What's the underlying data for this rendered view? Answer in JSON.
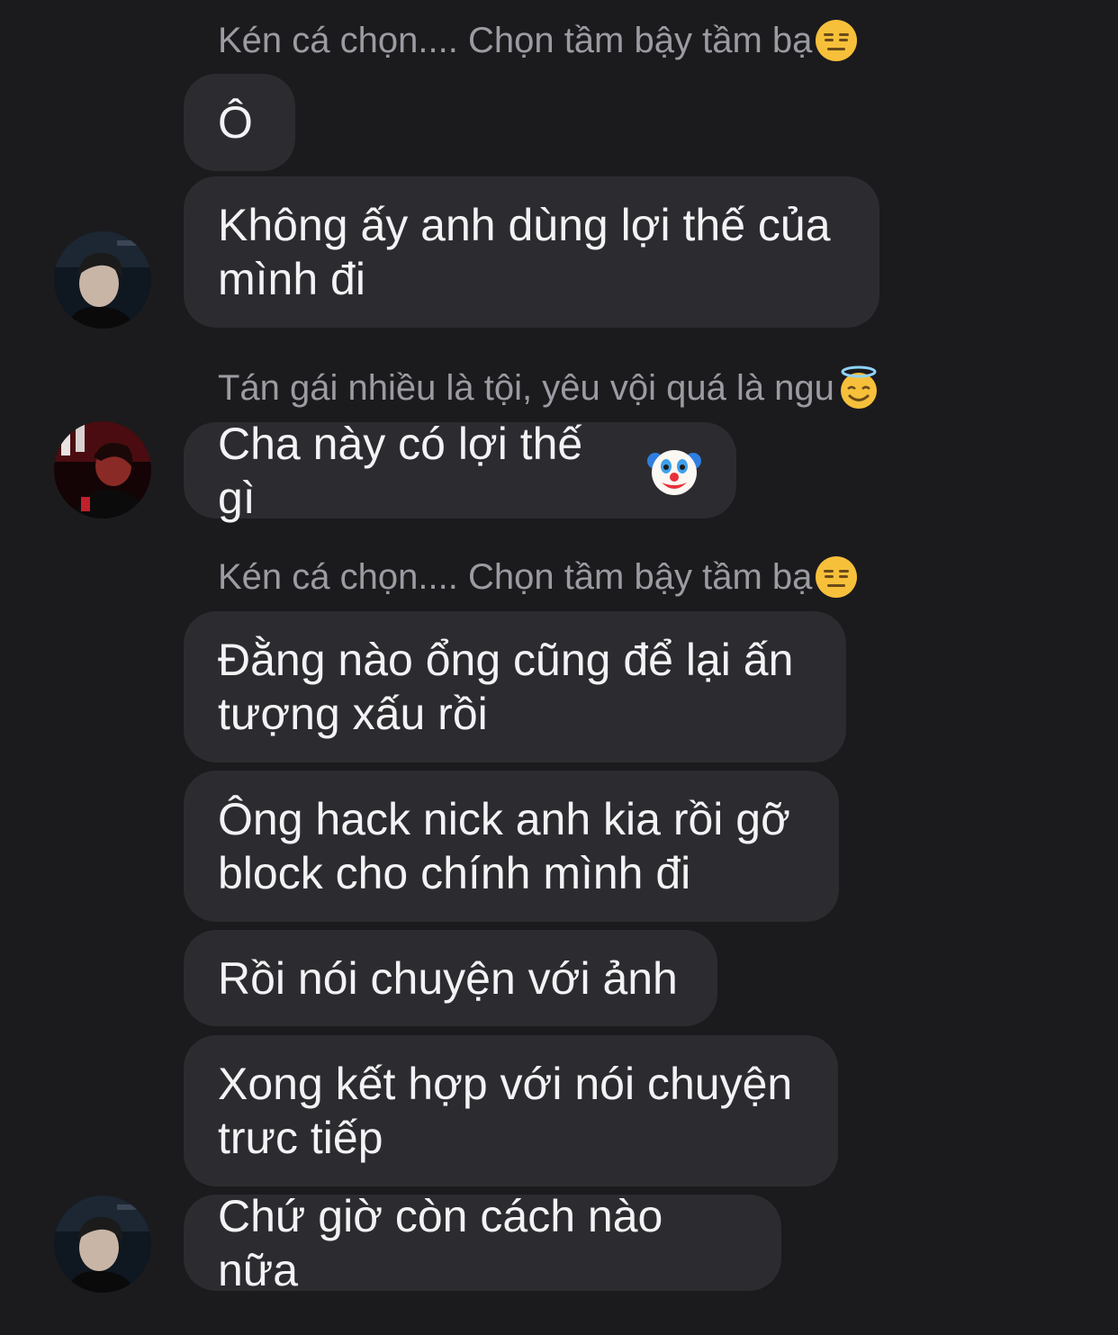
{
  "colors": {
    "background": "#1b1b1e",
    "bubble": "#2c2c30",
    "sender_text": "#9b9ba2",
    "message_text": "#f3f3f5"
  },
  "senders": {
    "s1": {
      "name": "Kén cá chọn.... Chọn tầm bậy tầm bạ",
      "emoji": "expressionless-face-icon"
    },
    "s2": {
      "name": "Tán gái nhiều là tội, yêu vội quá là ngu",
      "emoji": "smiling-face-with-halo-icon"
    },
    "s3": {
      "name": "Kén cá chọn.... Chọn tầm bậy tầm bạ",
      "emoji": "expressionless-face-icon"
    }
  },
  "messages": [
    {
      "text": "Ô"
    },
    {
      "text": "Không ấy anh dùng lợi thế của\nmình đi"
    },
    {
      "text": "Cha này có lợi thế gì",
      "emoji": "clown-face-icon"
    },
    {
      "text": "Đằng nào ổng cũng để lại ấn\ntượng xấu rồi"
    },
    {
      "text": "Ông hack nick anh kia rồi gỡ\nblock cho chính mình đi"
    },
    {
      "text": "Rồi nói chuyện với ảnh"
    },
    {
      "text": "Xong kết hợp với nói chuyện\ntrưc tiếp"
    },
    {
      "text": "Chứ giờ còn cách nào nữa"
    }
  ]
}
